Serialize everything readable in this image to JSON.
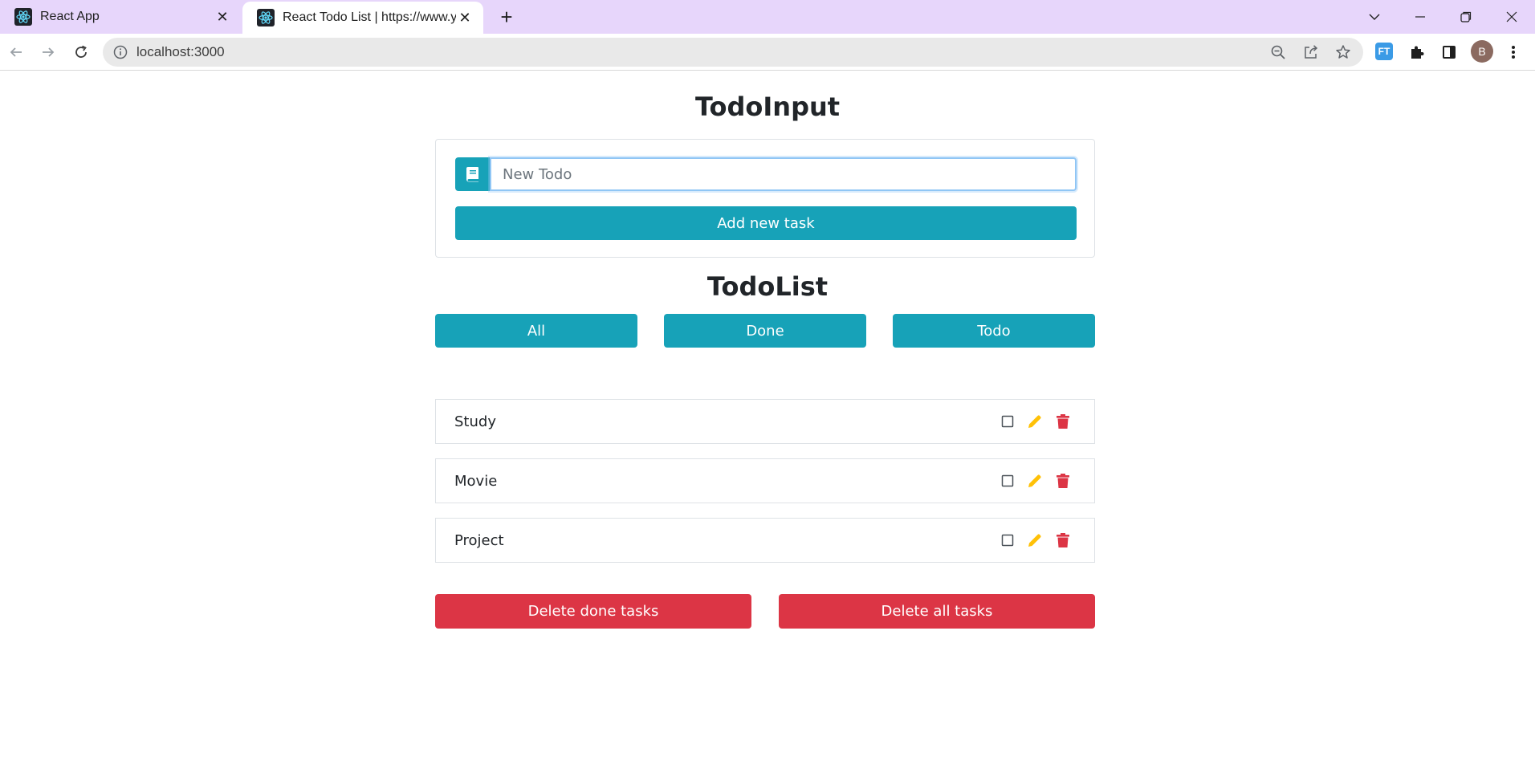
{
  "browser": {
    "tabs": [
      {
        "title": "React App",
        "active": false
      },
      {
        "title": "React Todo List | https://www.yo",
        "active": true
      }
    ],
    "address": "localhost:3000",
    "profile_initial": "B",
    "extension_label": "FT"
  },
  "todo_input": {
    "heading": "TodoInput",
    "placeholder": "New Todo",
    "value": "",
    "add_button": "Add new task"
  },
  "todo_list": {
    "heading": "TodoList",
    "filters": [
      "All",
      "Done",
      "Todo"
    ],
    "items": [
      {
        "text": "Study",
        "done": false
      },
      {
        "text": "Movie",
        "done": false
      },
      {
        "text": "Project",
        "done": false
      }
    ],
    "delete_done_button": "Delete done tasks",
    "delete_all_button": "Delete all tasks"
  },
  "colors": {
    "info": "#17a2b8",
    "danger": "#dc3545",
    "warning": "#ffc107",
    "tabstrip": "#e7d6fb"
  }
}
